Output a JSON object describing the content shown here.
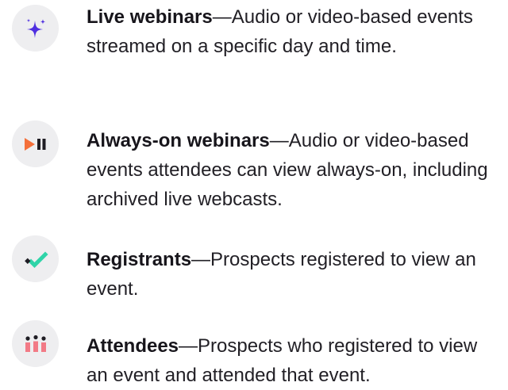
{
  "items": [
    {
      "title": "Live webinars",
      "description": "—Audio or video-based events streamed on a specific day and time.",
      "icon": "sparkle-icon"
    },
    {
      "title": "Always-on webinars",
      "description": "—Audio or video-based events attendees can view always-on, including archived live webcasts.",
      "icon": "play-pause-icon"
    },
    {
      "title": "Registrants",
      "description": "—Prospects registered to view an event.",
      "icon": "checkmark-icon"
    },
    {
      "title": "Attendees",
      "description": "—Prospects who registered to view an event and attended that event.",
      "icon": "people-icon"
    }
  ],
  "colors": {
    "icon_background": "#eeeef0",
    "sparkle": "#4f2fe0",
    "play": "#f46f3a",
    "pause": "#1f1d24",
    "check": "#2fd4a8",
    "people": "#f27a86"
  }
}
